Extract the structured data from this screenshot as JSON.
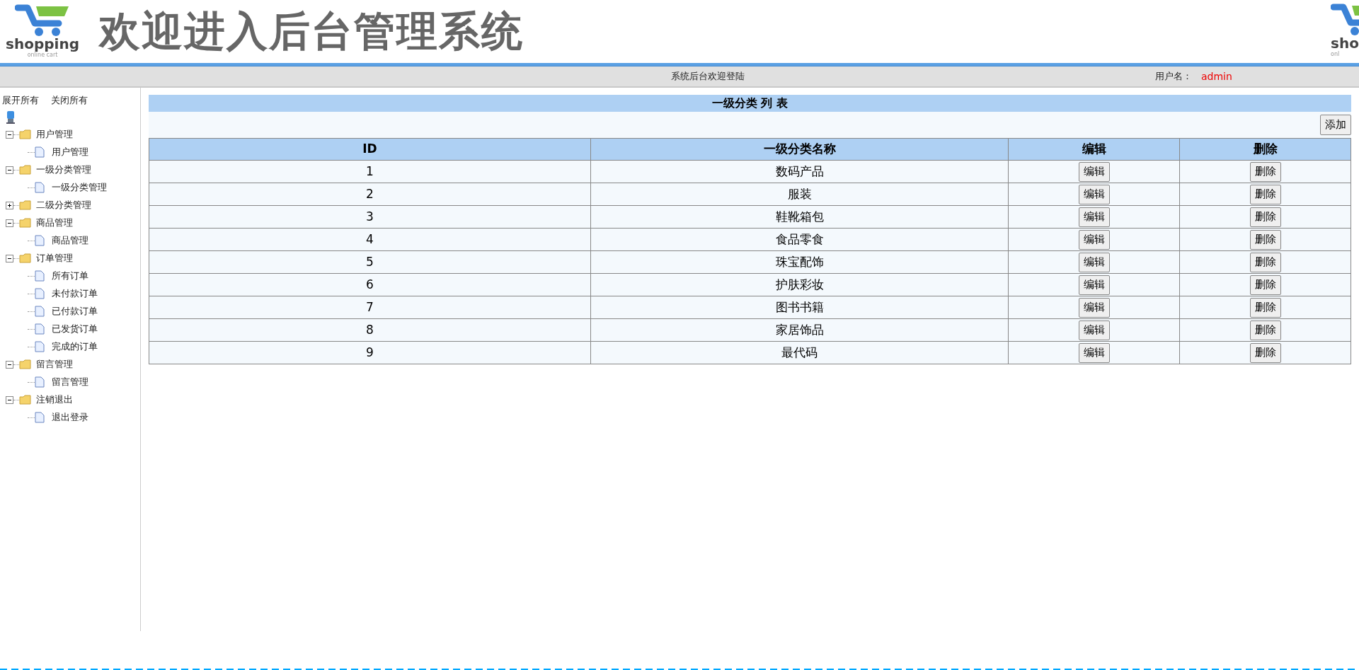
{
  "header": {
    "logo": {
      "name": "shopping",
      "tagline": "online cart"
    },
    "title": "欢迎进入后台管理系统",
    "logo_right": {
      "name": "sho",
      "tagline": "onl"
    }
  },
  "status_bar": {
    "welcome": "系统后台欢迎登陆",
    "user_label": "用户名：",
    "user_name": "admin"
  },
  "sidebar": {
    "expand_all": "展开所有",
    "collapse_all": "关闭所有",
    "tree": [
      {
        "label": "用户管理",
        "expanded": true,
        "children": [
          {
            "label": "用户管理"
          }
        ]
      },
      {
        "label": "一级分类管理",
        "expanded": true,
        "children": [
          {
            "label": "一级分类管理"
          }
        ]
      },
      {
        "label": "二级分类管理",
        "expanded": false
      },
      {
        "label": "商品管理",
        "expanded": true,
        "children": [
          {
            "label": "商品管理"
          }
        ]
      },
      {
        "label": "订单管理",
        "expanded": true,
        "children": [
          {
            "label": "所有订单"
          },
          {
            "label": "未付款订单"
          },
          {
            "label": "已付款订单"
          },
          {
            "label": "已发货订单"
          },
          {
            "label": "完成的订单"
          }
        ]
      },
      {
        "label": "留言管理",
        "expanded": true,
        "children": [
          {
            "label": "留言管理"
          }
        ]
      },
      {
        "label": "注销退出",
        "expanded": true,
        "children": [
          {
            "label": "退出登录"
          }
        ]
      }
    ]
  },
  "table": {
    "title": "一级分类 列 表",
    "add_button": "添加",
    "columns": [
      "ID",
      "一级分类名称",
      "编辑",
      "删除"
    ],
    "rows": [
      {
        "id": "1",
        "name": "数码产品",
        "edit": "编辑",
        "delete": "删除"
      },
      {
        "id": "2",
        "name": "服装",
        "edit": "编辑",
        "delete": "删除"
      },
      {
        "id": "3",
        "name": "鞋靴箱包",
        "edit": "编辑",
        "delete": "删除"
      },
      {
        "id": "4",
        "name": "食品零食",
        "edit": "编辑",
        "delete": "删除"
      },
      {
        "id": "5",
        "name": "珠宝配饰",
        "edit": "编辑",
        "delete": "删除"
      },
      {
        "id": "6",
        "name": "护肤彩妆",
        "edit": "编辑",
        "delete": "删除"
      },
      {
        "id": "7",
        "name": "图书书籍",
        "edit": "编辑",
        "delete": "删除"
      },
      {
        "id": "8",
        "name": "家居饰品",
        "edit": "编辑",
        "delete": "删除"
      },
      {
        "id": "9",
        "name": "最代码",
        "edit": "编辑",
        "delete": "删除"
      }
    ]
  }
}
